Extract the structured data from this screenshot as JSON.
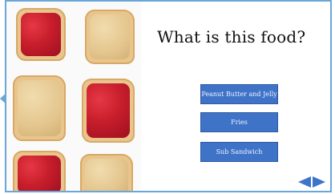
{
  "question": "What is this food?",
  "choices": [
    {
      "label": "Peanut Butter and Jelly"
    },
    {
      "label": "Fries"
    },
    {
      "label": "Sub Sandwich"
    }
  ],
  "nav": {
    "prev_icon": "arrow-left-icon",
    "next_icon": "arrow-right-icon"
  },
  "colors": {
    "accent": "#3f73c8",
    "frame": "#6aa6d8"
  }
}
